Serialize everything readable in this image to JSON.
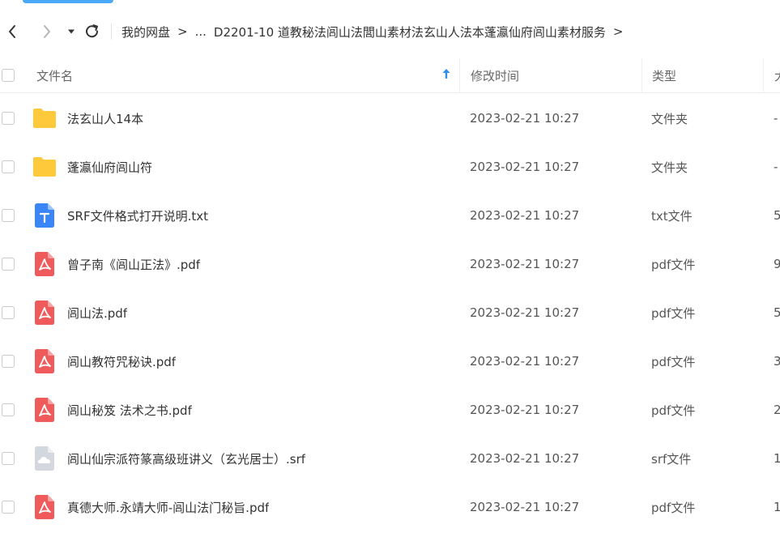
{
  "navigation": {
    "back_icon": "chevron-left-icon",
    "forward_icon": "chevron-right-icon",
    "dropdown_icon": "caret-down-icon",
    "refresh_icon": "refresh-icon",
    "breadcrumb": [
      {
        "label": "我的网盘"
      },
      {
        "label": "..."
      },
      {
        "label": "D2201-10 道教秘法闾山法閭山素材法玄山人法本蓬瀛仙府闾山素材服务"
      }
    ],
    "separator": ">"
  },
  "table": {
    "headers": {
      "name": "文件名",
      "modified": "修改时间",
      "type": "类型",
      "size": "大"
    },
    "sort_icon": "arrow-up-icon",
    "rows": [
      {
        "icon": "folder-icon",
        "name": "法玄山人14本",
        "modified": "2023-02-21 10:27",
        "type": "文件夹",
        "size": "-"
      },
      {
        "icon": "folder-icon",
        "name": "蓬瀛仙府闾山符",
        "modified": "2023-02-21 10:27",
        "type": "文件夹",
        "size": "-"
      },
      {
        "icon": "txt-file-icon",
        "name": "SRF文件格式打开说明.txt",
        "modified": "2023-02-21 10:27",
        "type": "txt文件",
        "size": "5"
      },
      {
        "icon": "pdf-file-icon",
        "name": "曾子南《闾山正法》.pdf",
        "modified": "2023-02-21 10:27",
        "type": "pdf文件",
        "size": "9"
      },
      {
        "icon": "pdf-file-icon",
        "name": "闾山法.pdf",
        "modified": "2023-02-21 10:27",
        "type": "pdf文件",
        "size": "5"
      },
      {
        "icon": "pdf-file-icon",
        "name": "闾山教符咒秘诀.pdf",
        "modified": "2023-02-21 10:27",
        "type": "pdf文件",
        "size": "3"
      },
      {
        "icon": "pdf-file-icon",
        "name": "闾山秘笈 法术之书.pdf",
        "modified": "2023-02-21 10:27",
        "type": "pdf文件",
        "size": "2"
      },
      {
        "icon": "srf-file-icon",
        "name": "闾山仙宗派符篆高级班讲义（玄光居士）.srf",
        "modified": "2023-02-21 10:27",
        "type": "srf文件",
        "size": "1"
      },
      {
        "icon": "pdf-file-icon",
        "name": "真德大师.永靖大师-闾山法门秘旨.pdf",
        "modified": "2023-02-21 10:27",
        "type": "pdf文件",
        "size": "1"
      }
    ]
  },
  "colors": {
    "accent": "#4aa9f7",
    "folder": "#ffc93c",
    "pdf": "#ef5b5b",
    "txt": "#3a86f7",
    "srf": "#d3d8de"
  }
}
